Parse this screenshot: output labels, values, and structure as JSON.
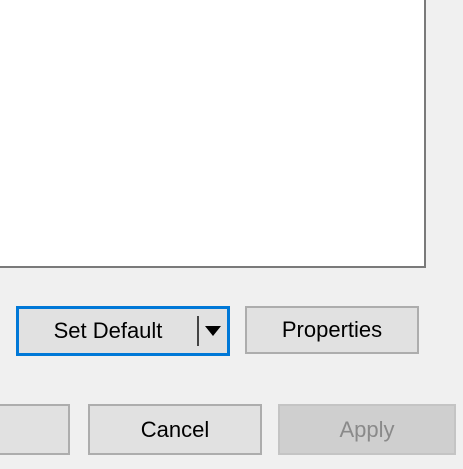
{
  "panel": {
    "set_default_label": "Set Default",
    "set_default_arrow_icon": "triangle-down-icon",
    "properties_label": "Properties"
  },
  "footer": {
    "left_button_label": "",
    "cancel_label": "Cancel",
    "apply_label": "Apply",
    "apply_enabled": false
  },
  "colors": {
    "window_bg": "#f0f0f0",
    "list_bg": "#ffffff",
    "focus_border": "#0078d7",
    "button_bg": "#e1e1e1",
    "disabled_text": "#8a8a8a"
  }
}
